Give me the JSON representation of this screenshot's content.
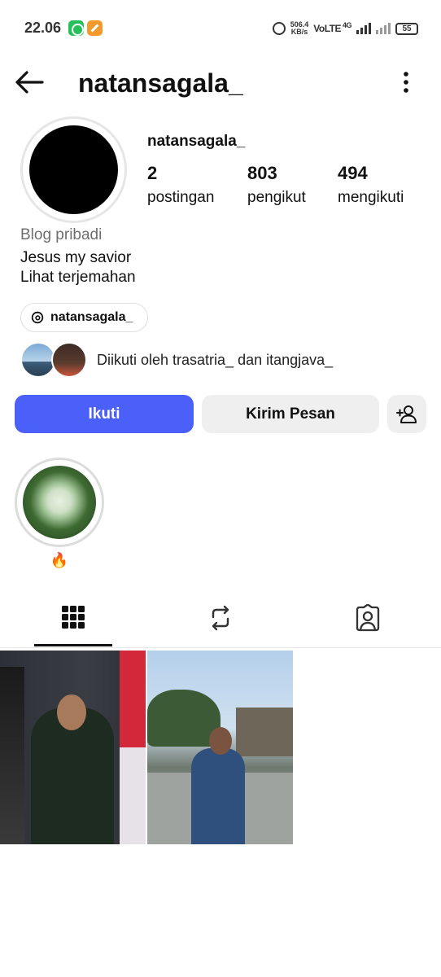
{
  "status_bar": {
    "time": "22.06",
    "net_speed_value": "506.4",
    "net_speed_unit": "KB/s",
    "volte": "VoLTE",
    "network": "4G",
    "battery": "55"
  },
  "header": {
    "username": "natansagala_"
  },
  "profile": {
    "display_name": "natansagala_",
    "stats": [
      {
        "value": "2",
        "label": "postingan"
      },
      {
        "value": "803",
        "label": "pengikut"
      },
      {
        "value": "494",
        "label": "mengikuti"
      }
    ],
    "category": "Blog pribadi",
    "bio": "Jesus my savior",
    "translate_link": "Lihat terjemahan",
    "threads_handle": "natansagala_",
    "followed_by": "Diikuti oleh trasatria_ dan itangjava_"
  },
  "actions": {
    "follow": "Ikuti",
    "message": "Kirim Pesan"
  },
  "highlights": [
    {
      "label": "🔥"
    }
  ],
  "tabs": [
    {
      "icon": "grid-icon",
      "active": true
    },
    {
      "icon": "reels-repost-icon",
      "active": false
    },
    {
      "icon": "tagged-icon",
      "active": false
    }
  ],
  "posts_count_shown": 2,
  "colors": {
    "primary_button": "#4b5ff9",
    "secondary_button": "#efefef"
  }
}
